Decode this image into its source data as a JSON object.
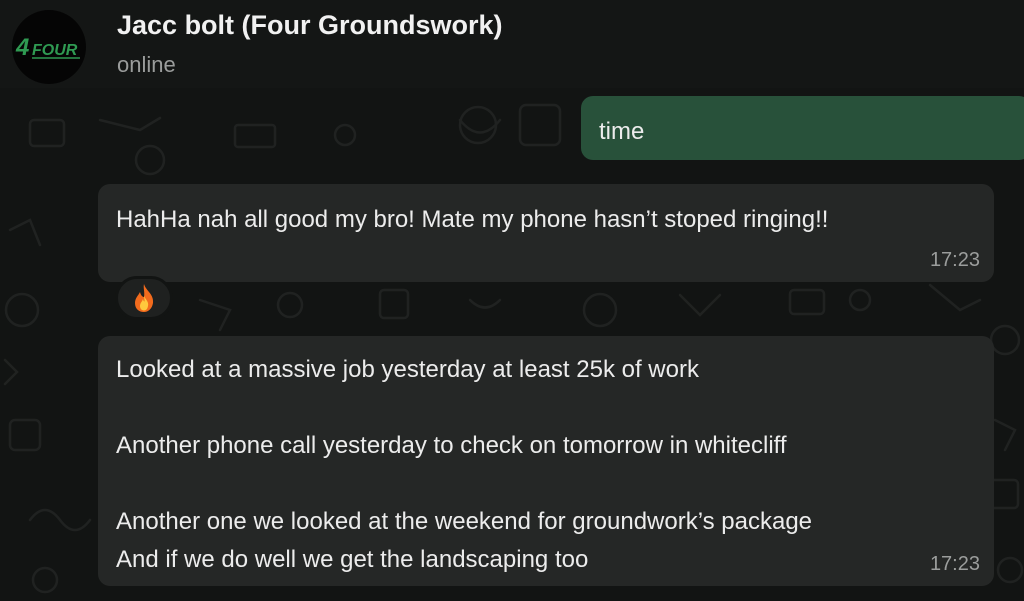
{
  "header": {
    "contact_name": "Jacc bolt (Four Groundswork)",
    "status": "online",
    "avatar_logo_text": "4FOUR"
  },
  "messages": [
    {
      "direction": "outgoing",
      "lines": [
        "time"
      ]
    },
    {
      "direction": "incoming",
      "lines": [
        "HahHa nah all good my bro! Mate my phone hasn’t stoped ringing!!"
      ],
      "time": "17:23",
      "reaction": "fire-emoji"
    },
    {
      "direction": "incoming",
      "lines": [
        "Looked at a massive job yesterday at least 25k of work",
        "",
        "Another phone call yesterday to check on tomorrow in whitecliff",
        "",
        "Another one we looked at the weekend for groundwork’s package",
        "And if we do well we get the landscaping too"
      ],
      "time": "17:23"
    }
  ],
  "colors": {
    "background": "#121413",
    "outgoing_bubble": "#28513a",
    "incoming_bubble": "#252726",
    "logo_green": "#2f9a52"
  }
}
